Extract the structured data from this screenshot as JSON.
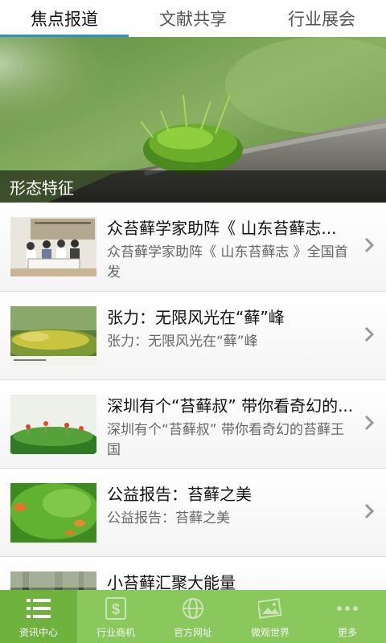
{
  "top_tabs": [
    {
      "label": "焦点报道",
      "active": true
    },
    {
      "label": "文献共享",
      "active": false
    },
    {
      "label": "行业展会",
      "active": false
    }
  ],
  "banner": {
    "caption": "形态特征"
  },
  "news": [
    {
      "title": "众苔藓学家助阵《 山东苔藓志...",
      "desc": "众苔藓学家助阵《 山东苔藓志 》全国首发"
    },
    {
      "title": "张力：无限风光在“藓”峰",
      "desc": "张力：无限风光在“藓”峰"
    },
    {
      "title": "深圳有个“苔藓叔” 带你看奇幻的...",
      "desc": "深圳有个“苔藓叔” 带你看奇幻的苔藓王国"
    },
    {
      "title": "公益报告：苔藓之美",
      "desc": "公益报告：苔藓之美"
    },
    {
      "title": "小苔藓汇聚大能量",
      "desc": ""
    }
  ],
  "bottom_nav": [
    {
      "label": "资讯中心",
      "icon": "list-icon",
      "active": true
    },
    {
      "label": "行业商机",
      "icon": "dollar-icon",
      "active": false
    },
    {
      "label": "官方网址",
      "icon": "globe-icon",
      "active": false
    },
    {
      "label": "微观世界",
      "icon": "photo-icon",
      "active": false
    },
    {
      "label": "更多",
      "icon": "more-icon",
      "active": false
    }
  ],
  "colors": {
    "tab_indicator": "#2b8fd6",
    "bottom_nav_bg": "#8ac75c",
    "bottom_nav_active": "#6fb23d"
  }
}
